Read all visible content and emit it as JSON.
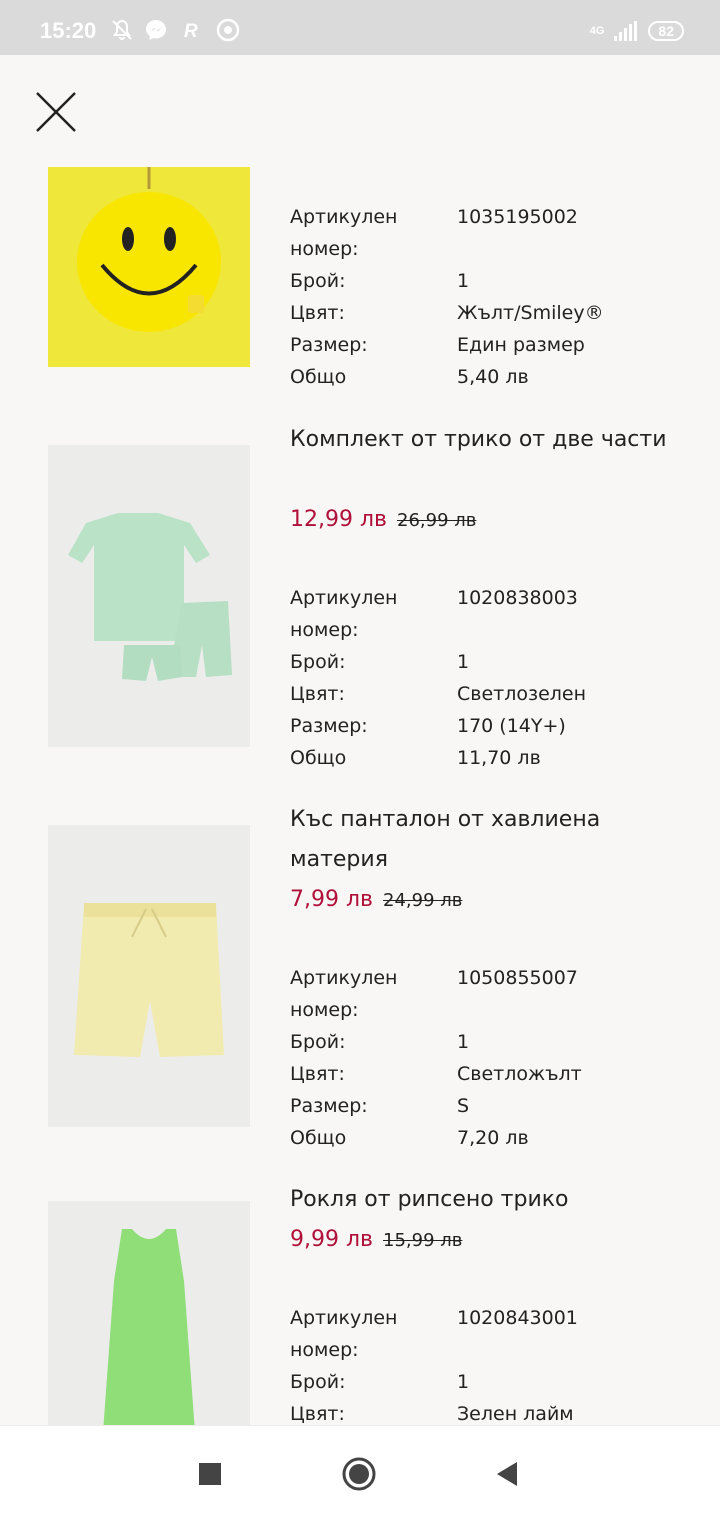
{
  "status_bar": {
    "time": "15:20",
    "network": "4G",
    "battery": "82"
  },
  "items": [
    {
      "details": [
        {
          "label": "Артикулен номер:",
          "value": "1035195002"
        },
        {
          "label": "Брой:",
          "value": "1"
        },
        {
          "label": "Цвят:",
          "value": "Жълт/Smiley®"
        },
        {
          "label": "Размер:",
          "value": "Един размер"
        },
        {
          "label": "Общо",
          "value": "5,40 лв"
        }
      ]
    },
    {
      "title": "Комплект от трико от две части",
      "sale_price": "12,99 лв",
      "original_price": "26,99 лв",
      "details": [
        {
          "label": "Артикулен номер:",
          "value": "1020838003"
        },
        {
          "label": "Брой:",
          "value": "1"
        },
        {
          "label": "Цвят:",
          "value": "Светлозелен"
        },
        {
          "label": "Размер:",
          "value": "170 (14Y+)"
        },
        {
          "label": "Общо",
          "value": "11,70 лв"
        }
      ]
    },
    {
      "title": "Къс панталон от хавлиена материя",
      "sale_price": "7,99 лв",
      "original_price": "24,99 лв",
      "details": [
        {
          "label": "Артикулен номер:",
          "value": "1050855007"
        },
        {
          "label": "Брой:",
          "value": "1"
        },
        {
          "label": "Цвят:",
          "value": "Светложълт"
        },
        {
          "label": "Размер:",
          "value": "S"
        },
        {
          "label": "Общо",
          "value": "7,20 лв"
        }
      ]
    },
    {
      "title": "Рокля от рипсено трико",
      "sale_price": "9,99 лв",
      "original_price": "15,99 лв",
      "details": [
        {
          "label": "Артикулен номер:",
          "value": "1020843001"
        },
        {
          "label": "Брой:",
          "value": "1"
        },
        {
          "label": "Цвят:",
          "value": "Зелен лайм"
        }
      ]
    }
  ],
  "colors": {
    "sale": "#b0103a",
    "background": "#f8f7f6",
    "status_bar": "#dadada"
  }
}
